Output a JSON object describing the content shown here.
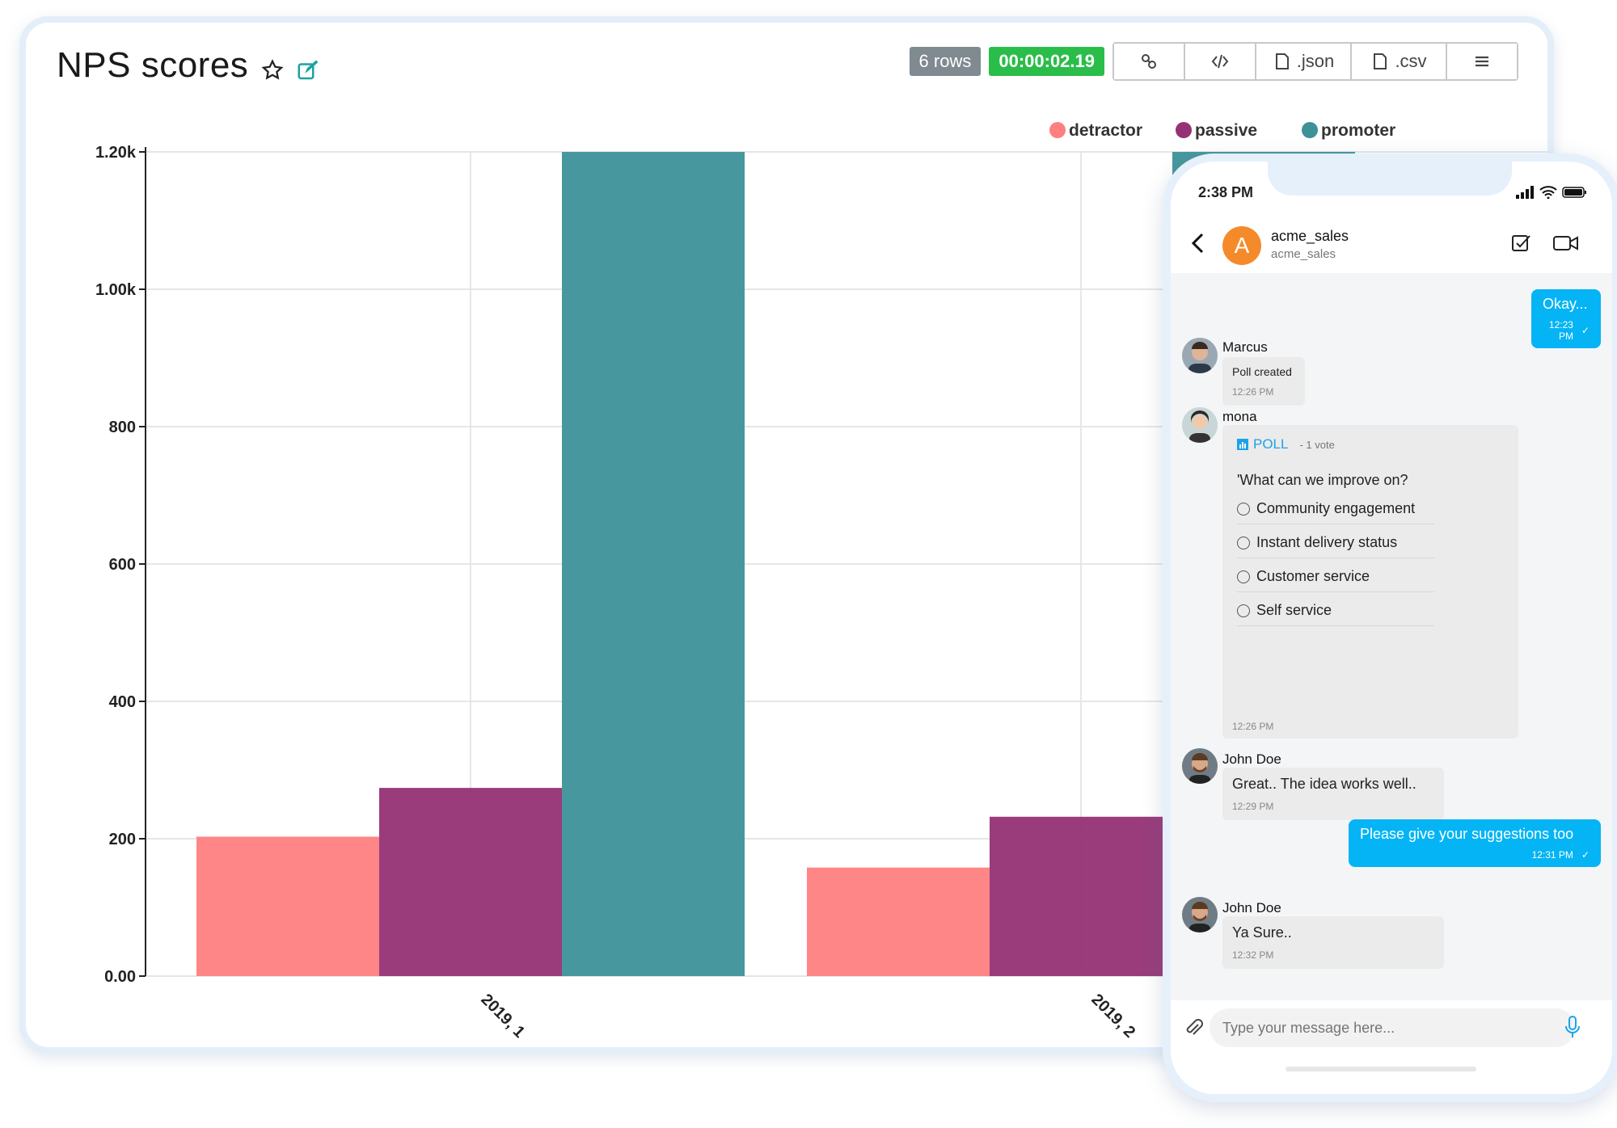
{
  "dashboard": {
    "title": "NPS scores",
    "rows_badge": "6 rows",
    "time_badge": "00:00:02.19",
    "toolbar": {
      "link_icon": "link-icon",
      "embed_icon": "code-icon",
      "json_label": ".json",
      "csv_label": ".csv",
      "menu_icon": "menu-icon"
    }
  },
  "chart_data": {
    "type": "bar",
    "title": "NPS scores",
    "categories": [
      "2019, 1",
      "2019, 2"
    ],
    "series": [
      {
        "name": "detractor",
        "color": "#ff7f7f",
        "values": [
          203,
          158
        ]
      },
      {
        "name": "passive",
        "color": "#953275",
        "values": [
          274,
          232
        ]
      },
      {
        "name": "promoter",
        "color": "#3d9199",
        "values": [
          1201,
          1201
        ]
      }
    ],
    "ylim": [
      0,
      1200
    ],
    "yticks": [
      "0.00",
      "200",
      "400",
      "600",
      "800",
      "1.00k",
      "1.20k"
    ],
    "grid": true,
    "legend": "top-right"
  },
  "phone": {
    "time": "2:38 PM",
    "contact_name": "acme_sales",
    "contact_sub": "acme_sales",
    "avatar_letter": "A",
    "messages": [
      {
        "text": "Okay...",
        "time": "12:23 PM"
      },
      {
        "sender": "Marcus",
        "text": "Poll created",
        "time": "12:26 PM"
      },
      {
        "sender": "mona",
        "poll_label": "POLL",
        "votes": "- 1 vote",
        "question": "'What can we improve on?",
        "options": [
          "Community engagement",
          "Instant delivery status",
          "Customer service",
          "Self service"
        ],
        "time": "12:26 PM"
      },
      {
        "sender": "John Doe",
        "text": "Great.. The idea works well..",
        "time": "12:29 PM"
      },
      {
        "text": "Please give your suggestions too",
        "time": "12:31 PM"
      },
      {
        "sender": "John Doe",
        "text": "Ya Sure..",
        "time": "12:32 PM"
      }
    ],
    "input_placeholder": "Type your message here..."
  }
}
